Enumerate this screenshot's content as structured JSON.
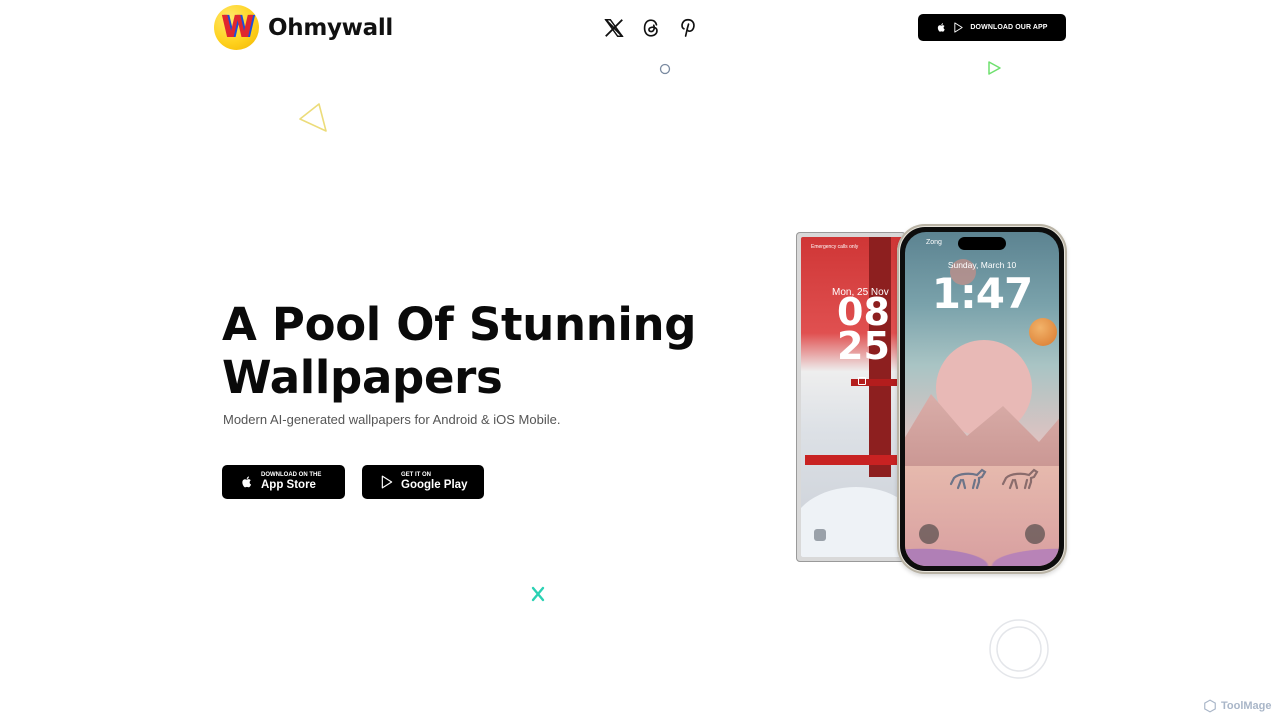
{
  "header": {
    "brand": "Ohmywall",
    "logo_letter": "W",
    "social": [
      {
        "name": "x-icon"
      },
      {
        "name": "threads-icon"
      },
      {
        "name": "pinterest-icon"
      }
    ],
    "download_button": "DOWNLOAD OUR APP"
  },
  "hero": {
    "title_line1": "A Pool Of Stunning",
    "title_line2": "Wallpapers",
    "subtitle": "Modern AI-generated wallpapers for Android & iOS Mobile.",
    "app_store": {
      "small": "DOWNLOAD ON THE",
      "big": "App Store"
    },
    "google_play": {
      "small": "GET IT ON",
      "big": "Google Play"
    }
  },
  "phone_back": {
    "status": "Emergency calls only",
    "date": "Mon, 25 Nov",
    "time_line1": "08",
    "time_line2": "25"
  },
  "phone_front": {
    "carrier": "Zong",
    "date": "Sunday, March 10",
    "time": "1:47"
  },
  "watermark": "ToolMage",
  "colors": {
    "accent": "#000000",
    "logo_yellow": "#ffd21f",
    "logo_red": "#e0262f"
  }
}
